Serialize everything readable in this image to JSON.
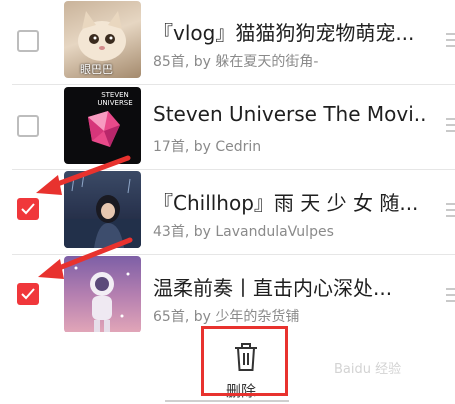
{
  "playlists": [
    {
      "title": "『vlog』猫猫狗狗宠物萌宠...",
      "subtitle": "85首, by 躲在夏天的街角-",
      "checked": false,
      "cover_text": "眼巴巴"
    },
    {
      "title": "Steven Universe The Movi...",
      "subtitle": "17首, by Cedrin",
      "checked": false,
      "cover_text": "STEVEN UNIVERSE"
    },
    {
      "title": "『Chillhop』雨 天 少 女 随...",
      "subtitle": "43首, by LavandulaVulpes",
      "checked": true
    },
    {
      "title": "温柔前奏丨直击内心深处...",
      "subtitle": "65首, by 少年的杂货铺",
      "checked": true
    }
  ],
  "actions": {
    "delete_label": "删除"
  },
  "watermark": "Baidu 经验",
  "colors": {
    "accent": "#f0373b",
    "annotation": "#e8322e"
  }
}
